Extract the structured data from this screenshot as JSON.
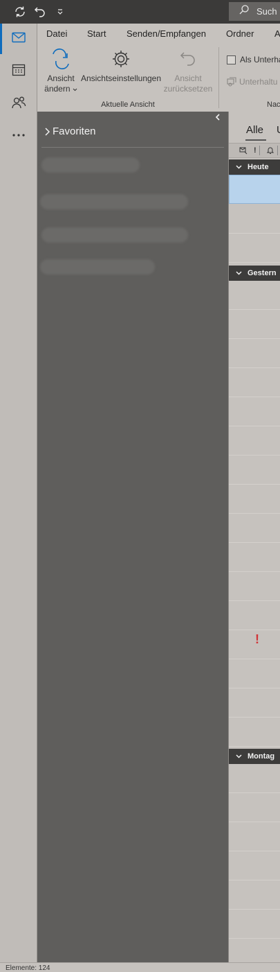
{
  "titlebar": {
    "search_label": "Such"
  },
  "ribbon": {
    "tabs": [
      {
        "label": "Datei"
      },
      {
        "label": "Start"
      },
      {
        "label": "Senden/Empfangen"
      },
      {
        "label": "Ordner"
      },
      {
        "label": "A"
      }
    ],
    "buttons": {
      "ansicht_aendern": {
        "line1": "Ansicht",
        "line2": "ändern"
      },
      "ansichtseinstellungen": {
        "label": "Ansichtseinstellungen"
      },
      "ansicht_zuruecksetzen": {
        "line1": "Ansicht",
        "line2": "zurücksetzen"
      }
    },
    "group_label": "Aktuelle Ansicht",
    "als_unterhaltungen": "Als Unterha",
    "unterhaltungen": "Unterhaltu",
    "next_group_label": "Nac"
  },
  "folder_pane": {
    "favorites_label": "Favoriten"
  },
  "message_list": {
    "filters": [
      {
        "label": "Alle"
      },
      {
        "label": "U"
      }
    ],
    "groups": [
      {
        "label": "Heute"
      },
      {
        "label": "Gestern"
      },
      {
        "label": "Montag"
      }
    ],
    "importance_marker": "!"
  },
  "status": {
    "items_label": "Elemente: 124"
  },
  "colors": {
    "accent": "#0f6cbd",
    "importance": "#d13438",
    "selection": "#b8d3ec"
  }
}
